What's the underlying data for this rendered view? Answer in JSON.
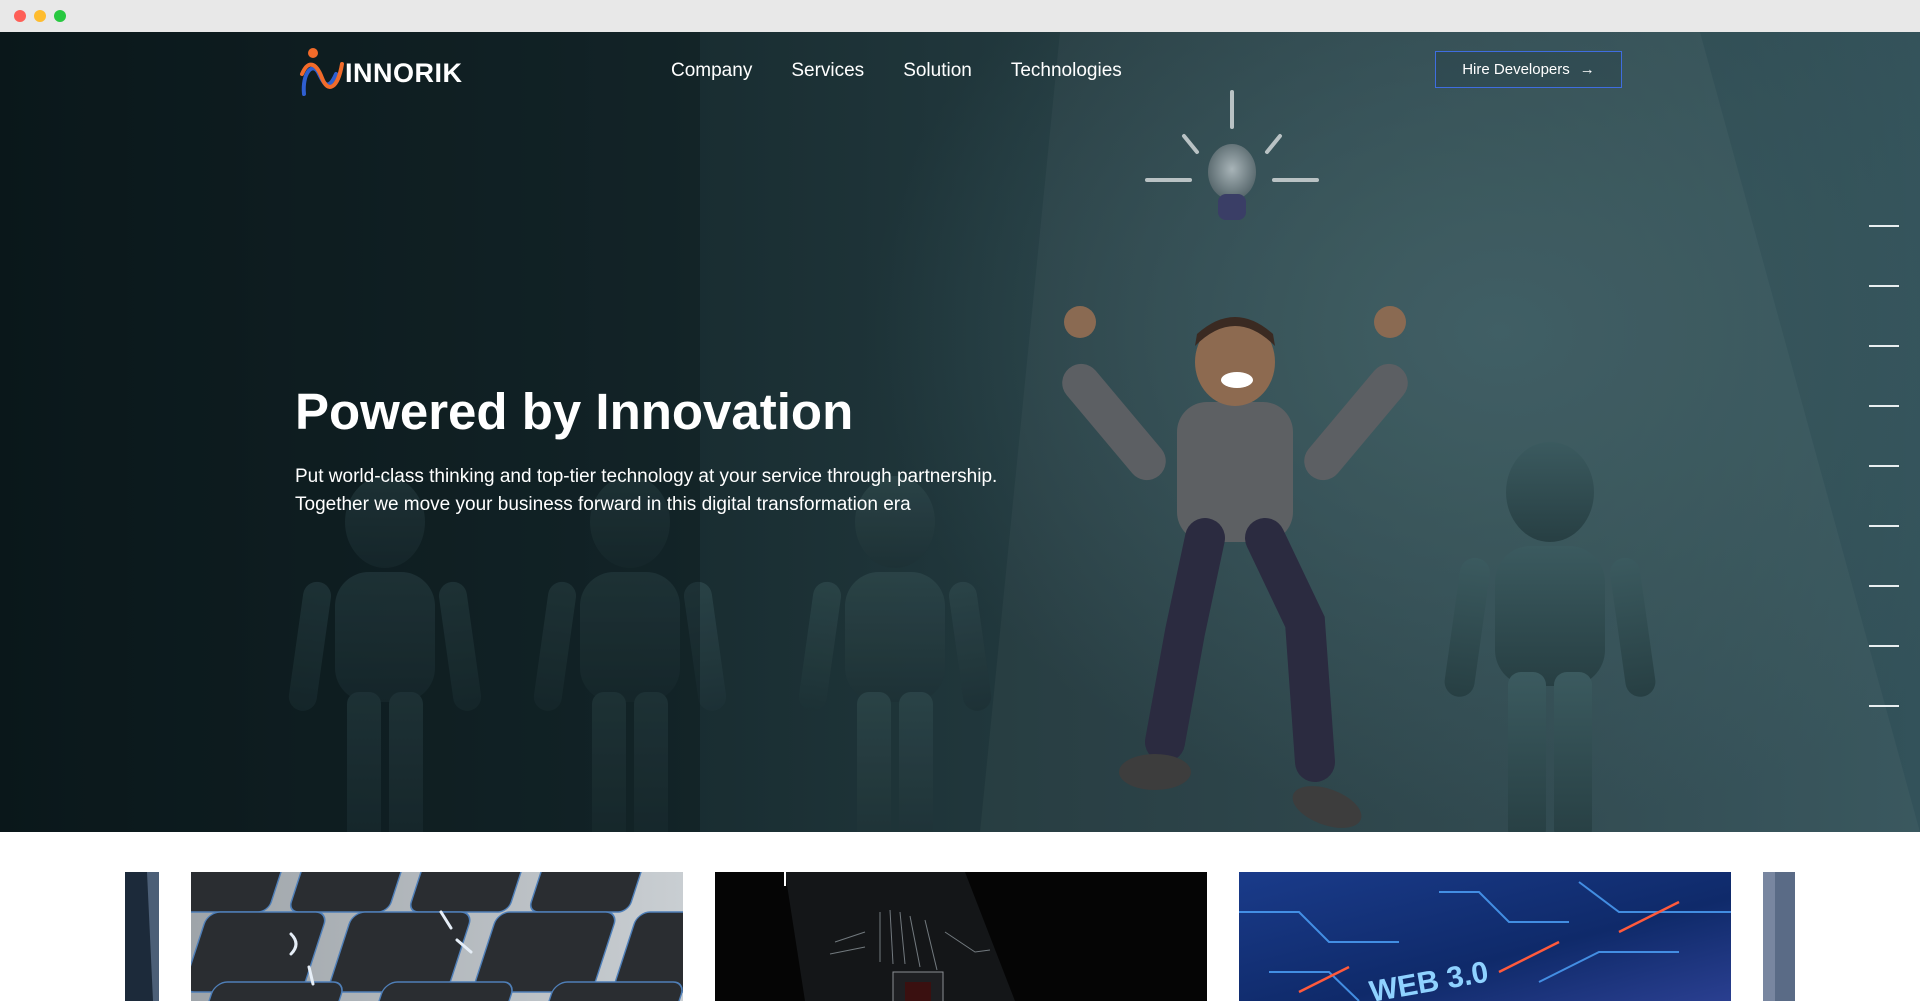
{
  "brand": {
    "name": "INNORIK"
  },
  "nav": {
    "items": [
      {
        "label": "Company"
      },
      {
        "label": "Services"
      },
      {
        "label": "Solution"
      },
      {
        "label": "Technologies"
      }
    ],
    "cta_label": "Hire Developers",
    "cta_icon": "arrow-right-icon"
  },
  "hero": {
    "title": "Powered by Innovation",
    "subtitle_line1": "Put world-class thinking and top-tier technology at your service through partnership.",
    "subtitle_line2": "Together we move your business forward in this digital transformation era"
  },
  "slider": {
    "count": 9
  },
  "cards": [
    {
      "name": "keyboard-image"
    },
    {
      "name": "circuit-chip-image"
    },
    {
      "name": "web3-image",
      "text": "WEB 3.0"
    }
  ],
  "colors": {
    "hero_bg": "#22393e",
    "cta_border": "#3f6de0",
    "logo_orange": "#f26b2a",
    "logo_blue": "#2f5fd0"
  }
}
